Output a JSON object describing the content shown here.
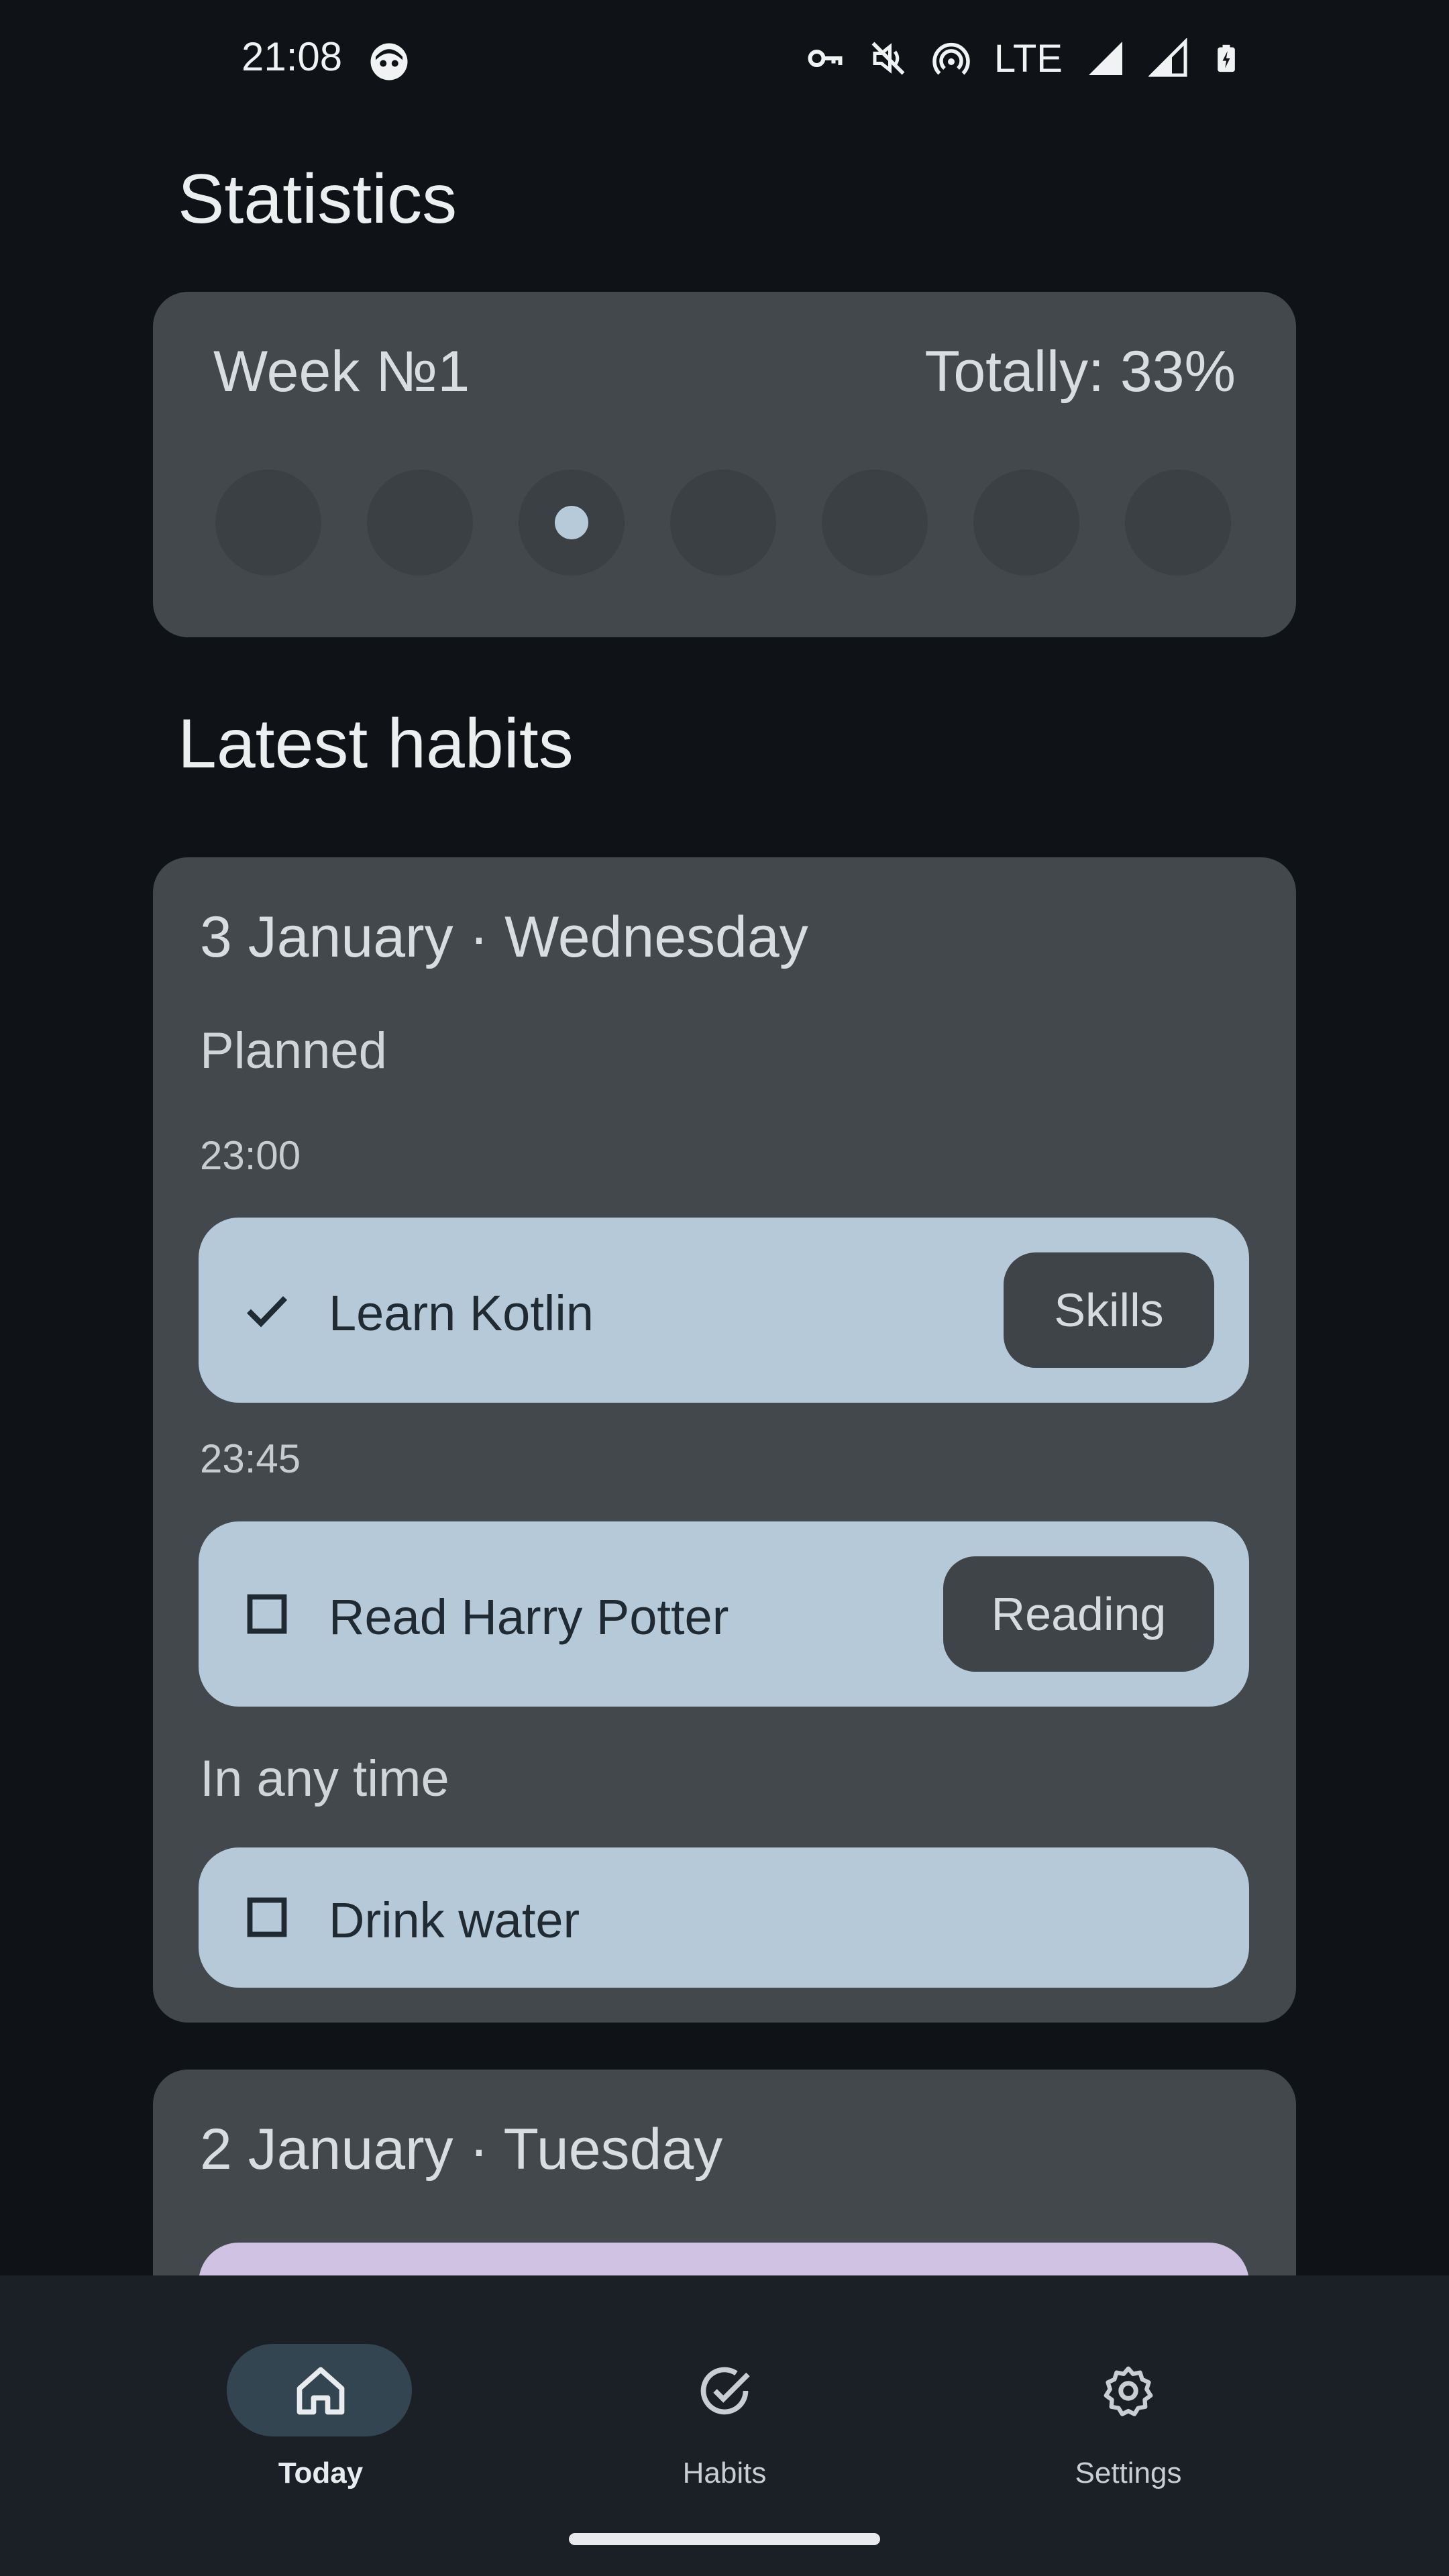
{
  "status_bar": {
    "time": "21:08",
    "network": "LTE",
    "icons": [
      "face-icon",
      "vpn-key-icon",
      "mute-icon",
      "hotspot-icon",
      "signal-icon",
      "signal-icon",
      "battery-charging-icon"
    ]
  },
  "statistics": {
    "title": "Statistics",
    "week_label": "Week №1",
    "total_label": "Totally: 33%",
    "days_marked": [
      false,
      false,
      true,
      false,
      false,
      false,
      false
    ]
  },
  "latest_habits": {
    "title": "Latest habits",
    "days": [
      {
        "date": "3 January · Wednesday",
        "planned_label": "Planned",
        "planned": [
          {
            "time": "23:00",
            "name": "Learn Kotlin",
            "done": true,
            "tag": "Skills"
          },
          {
            "time": "23:45",
            "name": "Read Harry Potter",
            "done": false,
            "tag": "Reading"
          }
        ],
        "anytime_label": "In any time",
        "anytime": [
          {
            "name": "Drink water",
            "done": false
          }
        ]
      },
      {
        "date": "2 January · Tuesday"
      }
    ]
  },
  "bottom_nav": {
    "items": [
      {
        "label": "Today",
        "icon": "home-icon",
        "active": true
      },
      {
        "label": "Habits",
        "icon": "check-circle-icon",
        "active": false
      },
      {
        "label": "Settings",
        "icon": "gear-icon",
        "active": false
      }
    ]
  },
  "colors": {
    "background": "#0f1317",
    "card": "#42484c",
    "habit_item": "#b5c9d9",
    "tag": "#3e4448",
    "nav_bar": "#1b2027",
    "nav_active_pill": "#334550"
  }
}
